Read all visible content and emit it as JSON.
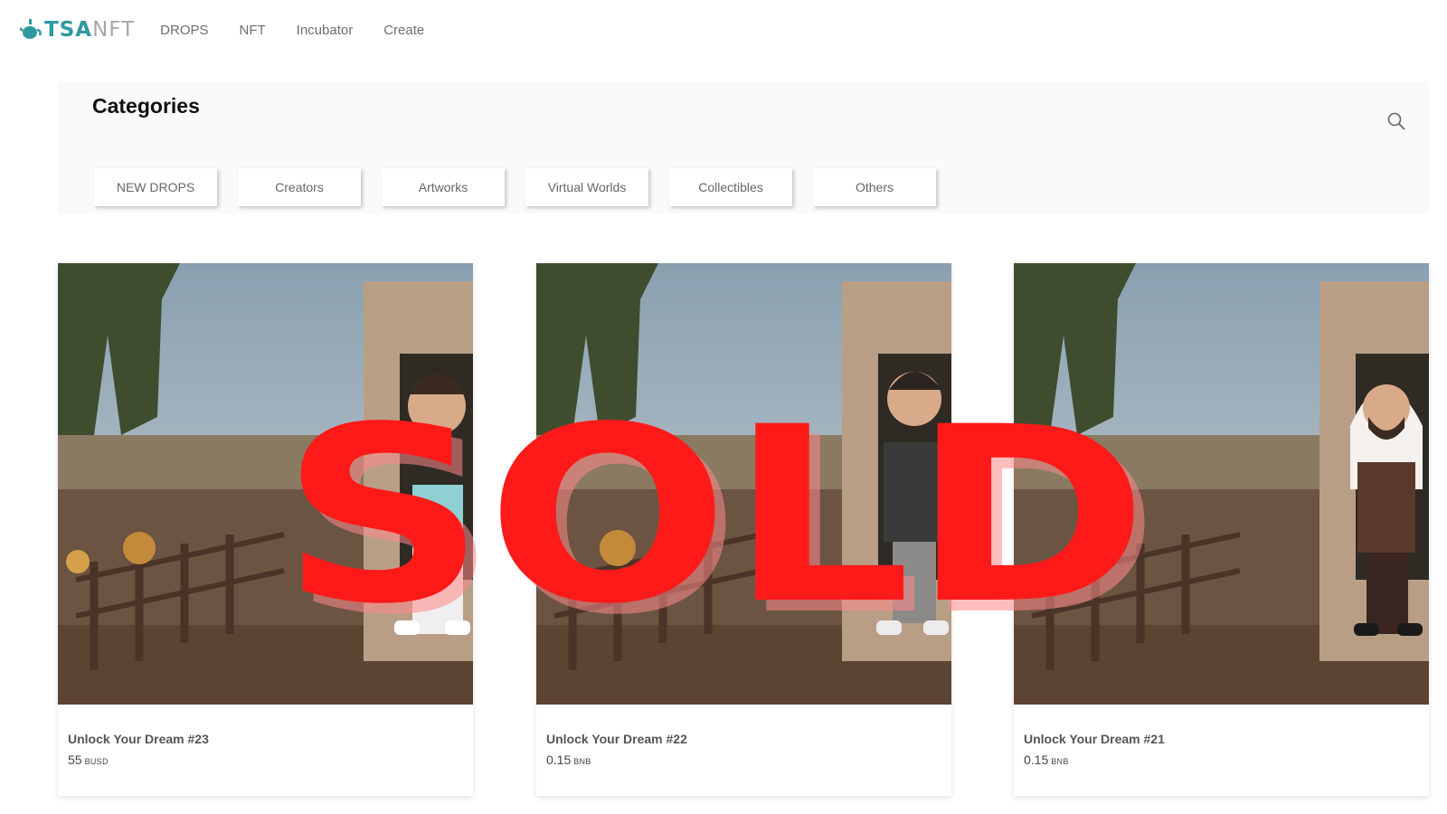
{
  "brand": {
    "name_part1": "TSA",
    "name_part2": "NFT"
  },
  "nav": {
    "items": [
      "DROPS",
      "NFT",
      "Incubator",
      "Create"
    ]
  },
  "categories": {
    "title": "Categories",
    "tabs": [
      "NEW DROPS",
      "Creators",
      "Artworks",
      "Virtual Worlds",
      "Collectibles",
      "Others"
    ]
  },
  "cards": [
    {
      "title": "Unlock Your Dream #23",
      "price": "55",
      "unit": "BUSD"
    },
    {
      "title": "Unlock Your Dream #22",
      "price": "0.15",
      "unit": "BNB"
    },
    {
      "title": "Unlock Your Dream #21",
      "price": "0.15",
      "unit": "BNB"
    }
  ],
  "sold_label": "SOLD",
  "colors": {
    "accent": "#2e9aa0",
    "sold": "#ff1a1a"
  },
  "icons": {
    "search": "search-icon",
    "logo": "teapot-logo-icon"
  }
}
